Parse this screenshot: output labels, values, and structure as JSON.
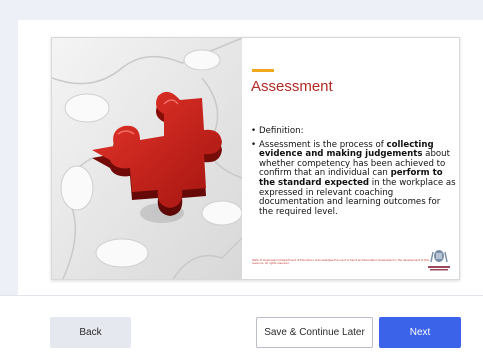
{
  "slide": {
    "title": "Assessment",
    "bullet_1": "Definition:",
    "bullet_2": {
      "t1": "Assessment is the process of ",
      "b1": "collecting evidence and making judgements",
      "t2": " about whether competency has been achieved to confirm that an individual can ",
      "b2": "perform to the standard expected",
      "t3": " in the workplace as expressed in relevant coaching documentation and learning outcomes for the required level."
    },
    "footnote": "State of Queensland (Department of Education) acknowledges the input of Sport and Recreation Queensland in the development of this resource. All rights reserved.",
    "image_icon": "red-puzzle-piece-image",
    "logo_icon": "queensland-government-crest-icon"
  },
  "footer": {
    "back_label": "Back",
    "save_label": "Save & Continue Later",
    "next_label": "Next"
  },
  "colors": {
    "page_bg": "#eef0f7",
    "title": "#b22a24",
    "accent": "#f0a81c",
    "next_button": "#3a63ea",
    "back_button": "#e6e8f0"
  }
}
